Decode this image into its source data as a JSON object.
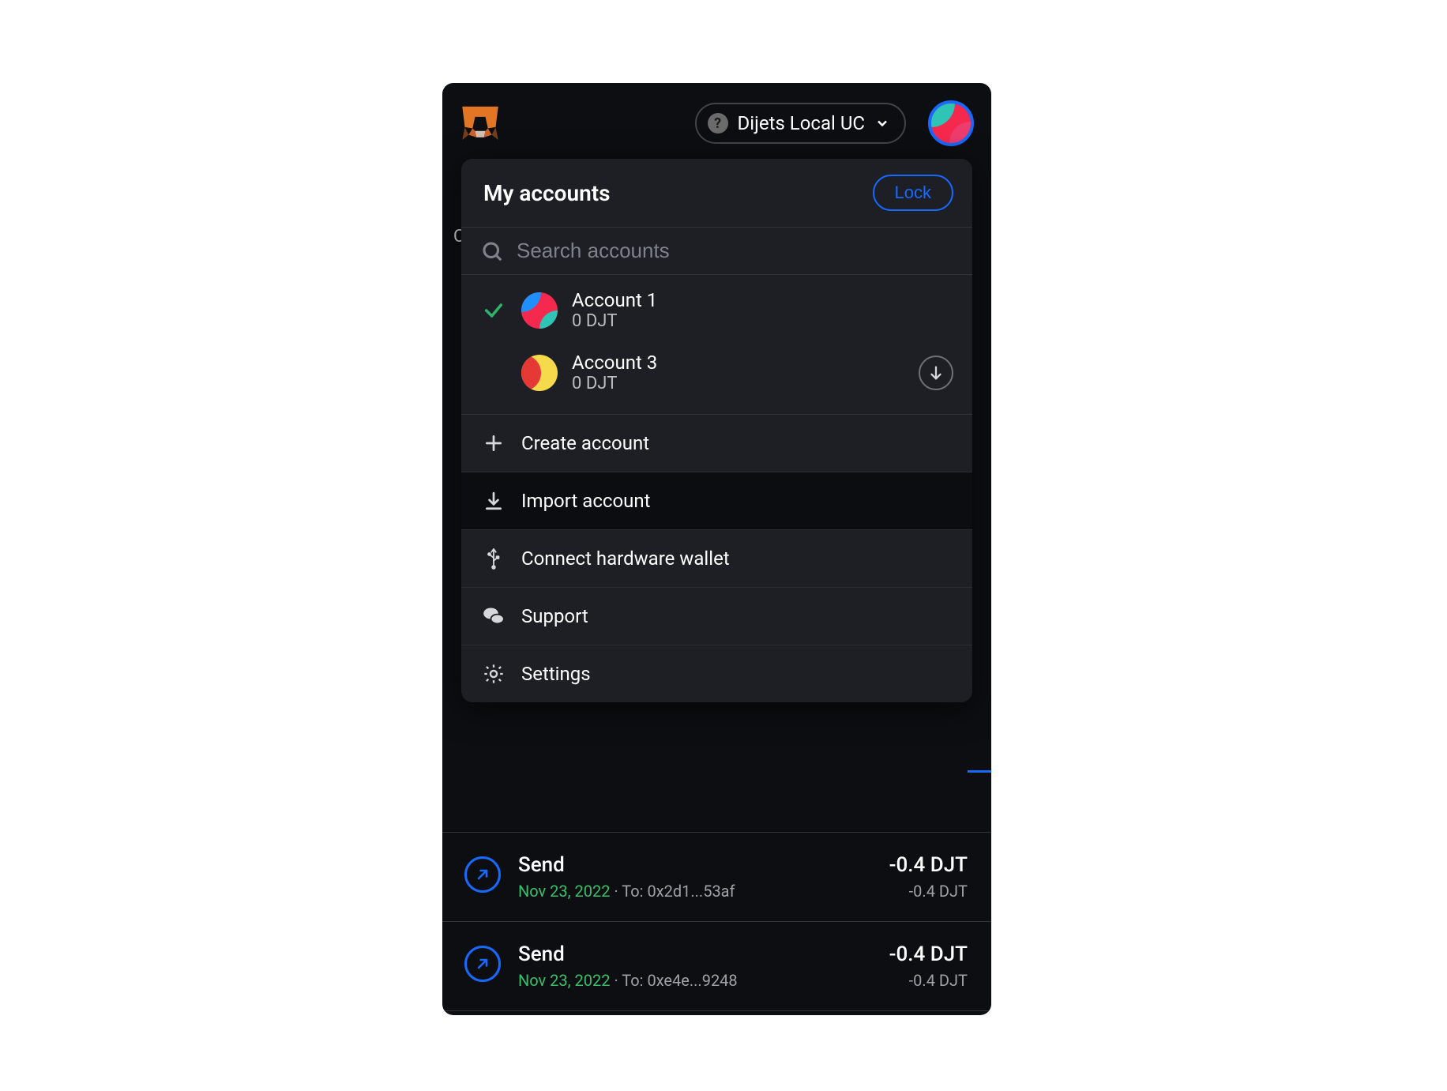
{
  "header": {
    "network_label": "Dijets Local UC"
  },
  "dropdown": {
    "title": "My accounts",
    "lock_label": "Lock",
    "search_placeholder": "Search accounts",
    "accounts": [
      {
        "name": "Account 1",
        "balance": "0 DJT",
        "selected": true
      },
      {
        "name": "Account 3",
        "balance": "0 DJT",
        "selected": false
      }
    ],
    "menu": {
      "create": "Create account",
      "import": "Import account",
      "connect_hw": "Connect hardware wallet",
      "support": "Support",
      "settings": "Settings"
    }
  },
  "transactions": [
    {
      "title": "Send",
      "date": "Nov 23, 2022",
      "to_label": "To: 0x2d1...53af",
      "amount_main": "-0.4 DJT",
      "amount_sub": "-0.4 DJT"
    },
    {
      "title": "Send",
      "date": "Nov 23, 2022",
      "to_label": "To: 0xe4e...9248",
      "amount_main": "-0.4 DJT",
      "amount_sub": "-0.4 DJT"
    }
  ]
}
